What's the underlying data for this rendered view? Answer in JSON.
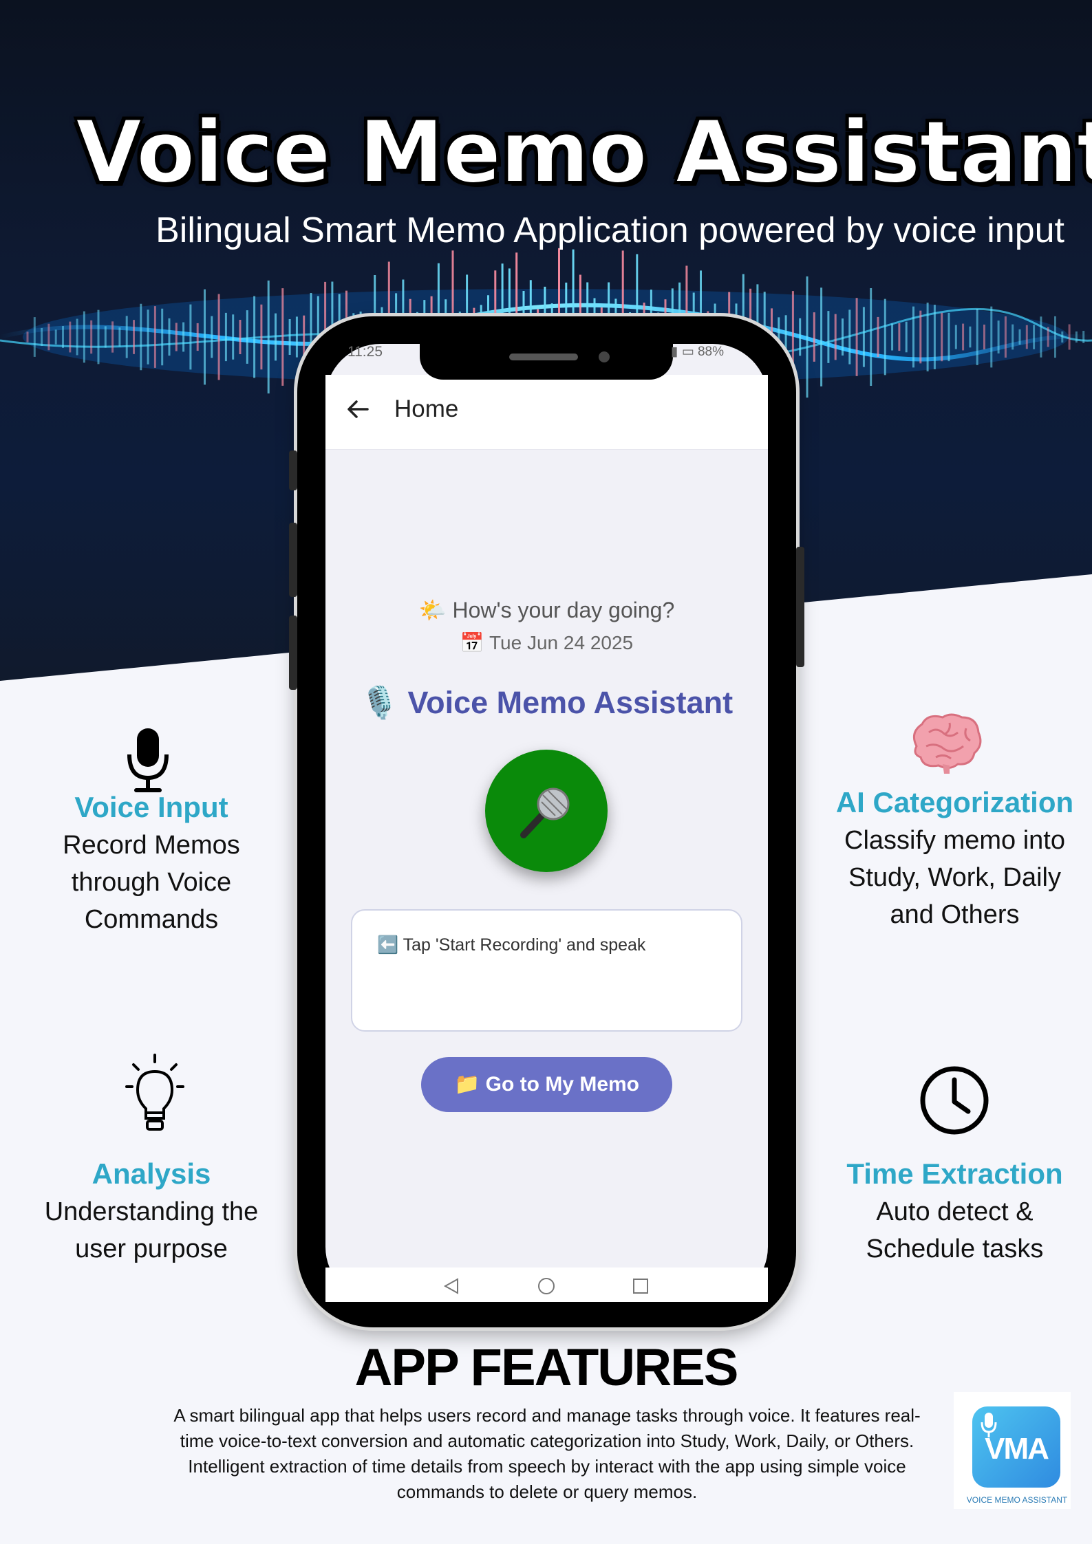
{
  "header": {
    "title": "Voice Memo Assistant",
    "subtitle": "Bilingual Smart Memo Application powered by voice input"
  },
  "phone": {
    "status": {
      "time": "11:25",
      "battery": "88%"
    },
    "appbar": {
      "title": "Home"
    },
    "greeting": "🌤️ How's your day going?",
    "date": "📅 Tue Jun 24 2025",
    "app_title": "🎙️ Voice Memo Assistant",
    "transcript_placeholder": "⬅️ Tap 'Start Recording' and speak",
    "memo_button": "📁 Go to My Memo"
  },
  "features": {
    "voice_input": {
      "title": "Voice Input",
      "lines": [
        "Record Memos",
        "through Voice",
        "Commands"
      ],
      "icon": "microphone-icon"
    },
    "ai_categorization": {
      "title": "AI Categorization",
      "lines": [
        "Classify memo into",
        "Study, Work, Daily",
        "and Others"
      ],
      "icon": "brain-icon"
    },
    "analysis": {
      "title": "Analysis",
      "lines": [
        "Understanding the",
        "user purpose"
      ],
      "icon": "lightbulb-icon"
    },
    "time_extraction": {
      "title": "Time Extraction",
      "lines": [
        "Auto detect &",
        "Schedule tasks"
      ],
      "icon": "clock-icon"
    }
  },
  "footer": {
    "section_title": "APP FEATURES",
    "description": "A smart bilingual app that helps users record and manage tasks through voice. It features real-time voice-to-text conversion and automatic categorization into Study, Work, Daily, or Others. Intelligent extraction of time details from speech by interact with the app using simple voice commands to delete or query memos.",
    "logo_text": "VMA",
    "logo_caption": "VOICE MEMO ASSISTANT"
  },
  "colors": {
    "accent": "#2ea7c7",
    "app_title": "#4b53a9",
    "memo_button": "#6a71c7",
    "mic_button": "#0a8a0a"
  }
}
